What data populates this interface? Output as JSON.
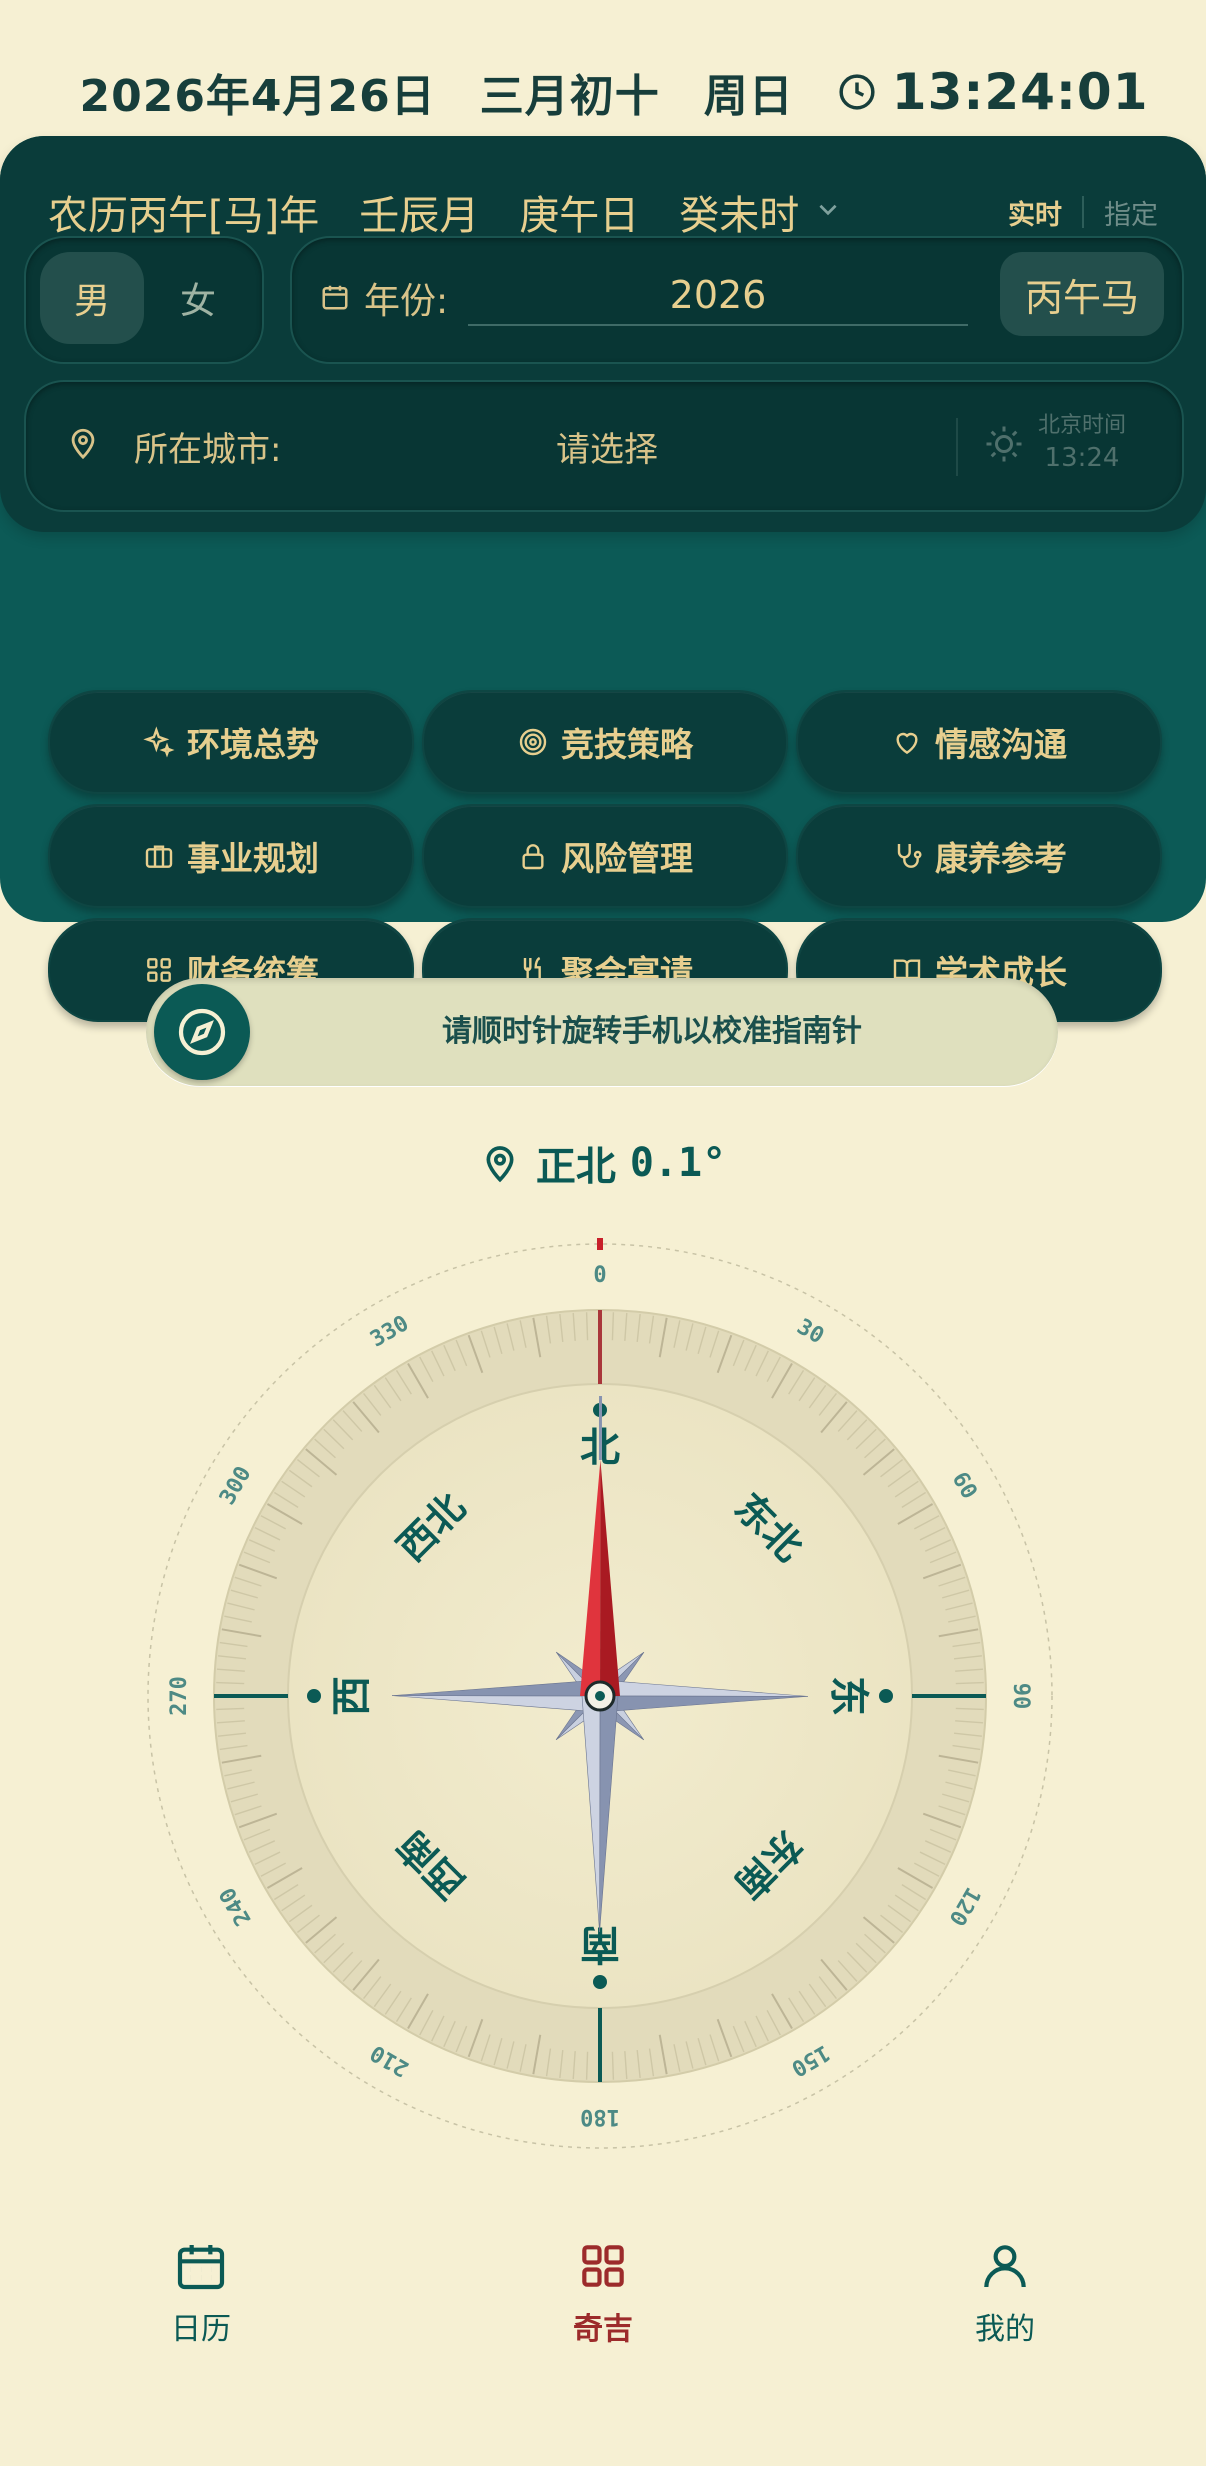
{
  "status": {
    "date": "2026年4月26日",
    "lunar_date": "三月初十",
    "weekday": "周日",
    "time": "13:24:01"
  },
  "lunar": {
    "year": "农历丙午[马]年",
    "month": "壬辰月",
    "day": "庚午日",
    "hour": "癸未时",
    "mode_realtime": "实时",
    "mode_specified": "指定"
  },
  "gender": {
    "male": "男",
    "female": "女",
    "selected": "男"
  },
  "year_input": {
    "label": "年份:",
    "value": "2026",
    "ganzhi": "丙午马"
  },
  "city": {
    "label": "所在城市:",
    "value": "请选择",
    "beijing_label": "北京时间",
    "beijing_time": "13:24"
  },
  "categories": [
    {
      "label": "环境总势",
      "icon": "sparkles-icon"
    },
    {
      "label": "竞技策略",
      "icon": "target-icon"
    },
    {
      "label": "情感沟通",
      "icon": "heart-icon"
    },
    {
      "label": "事业规划",
      "icon": "briefcase-icon"
    },
    {
      "label": "风险管理",
      "icon": "lock-icon"
    },
    {
      "label": "康养参考",
      "icon": "stethoscope-icon"
    },
    {
      "label": "财务统筹",
      "icon": "grid-icon"
    },
    {
      "label": "聚会宴请",
      "icon": "fork-knife-icon"
    },
    {
      "label": "学术成长",
      "icon": "book-icon"
    }
  ],
  "calibration": {
    "text": "请顺时针旋转手机以校准指南针"
  },
  "heading": {
    "direction": "正北",
    "degrees": "0.1°"
  },
  "compass": {
    "heading_deg": 0.1,
    "degree_labels": [
      "0",
      "30",
      "60",
      "90",
      "120",
      "150",
      "180",
      "210",
      "240",
      "270",
      "300",
      "330"
    ],
    "cardinals": {
      "north": "北",
      "east": "东",
      "south": "南",
      "west": "西"
    },
    "intercardinals": {
      "ne": "东北",
      "se": "东南",
      "sw": "西南",
      "nw": "西北"
    },
    "colors": {
      "teal": "#0b5a55",
      "red": "#c8202a",
      "needle_silver": "#8a99b8"
    }
  },
  "tabs": [
    {
      "label": "日历",
      "icon": "calendar-icon",
      "active": false
    },
    {
      "label": "奇吉",
      "icon": "grid-icon",
      "active": true
    },
    {
      "label": "我的",
      "icon": "person-icon",
      "active": false
    }
  ],
  "theme": {
    "background": "#f6f0d3",
    "panel": "#0c5a56",
    "card": "#0a3c3a",
    "gold": "#e7cf8f",
    "accent_red": "#9c2b2b"
  }
}
